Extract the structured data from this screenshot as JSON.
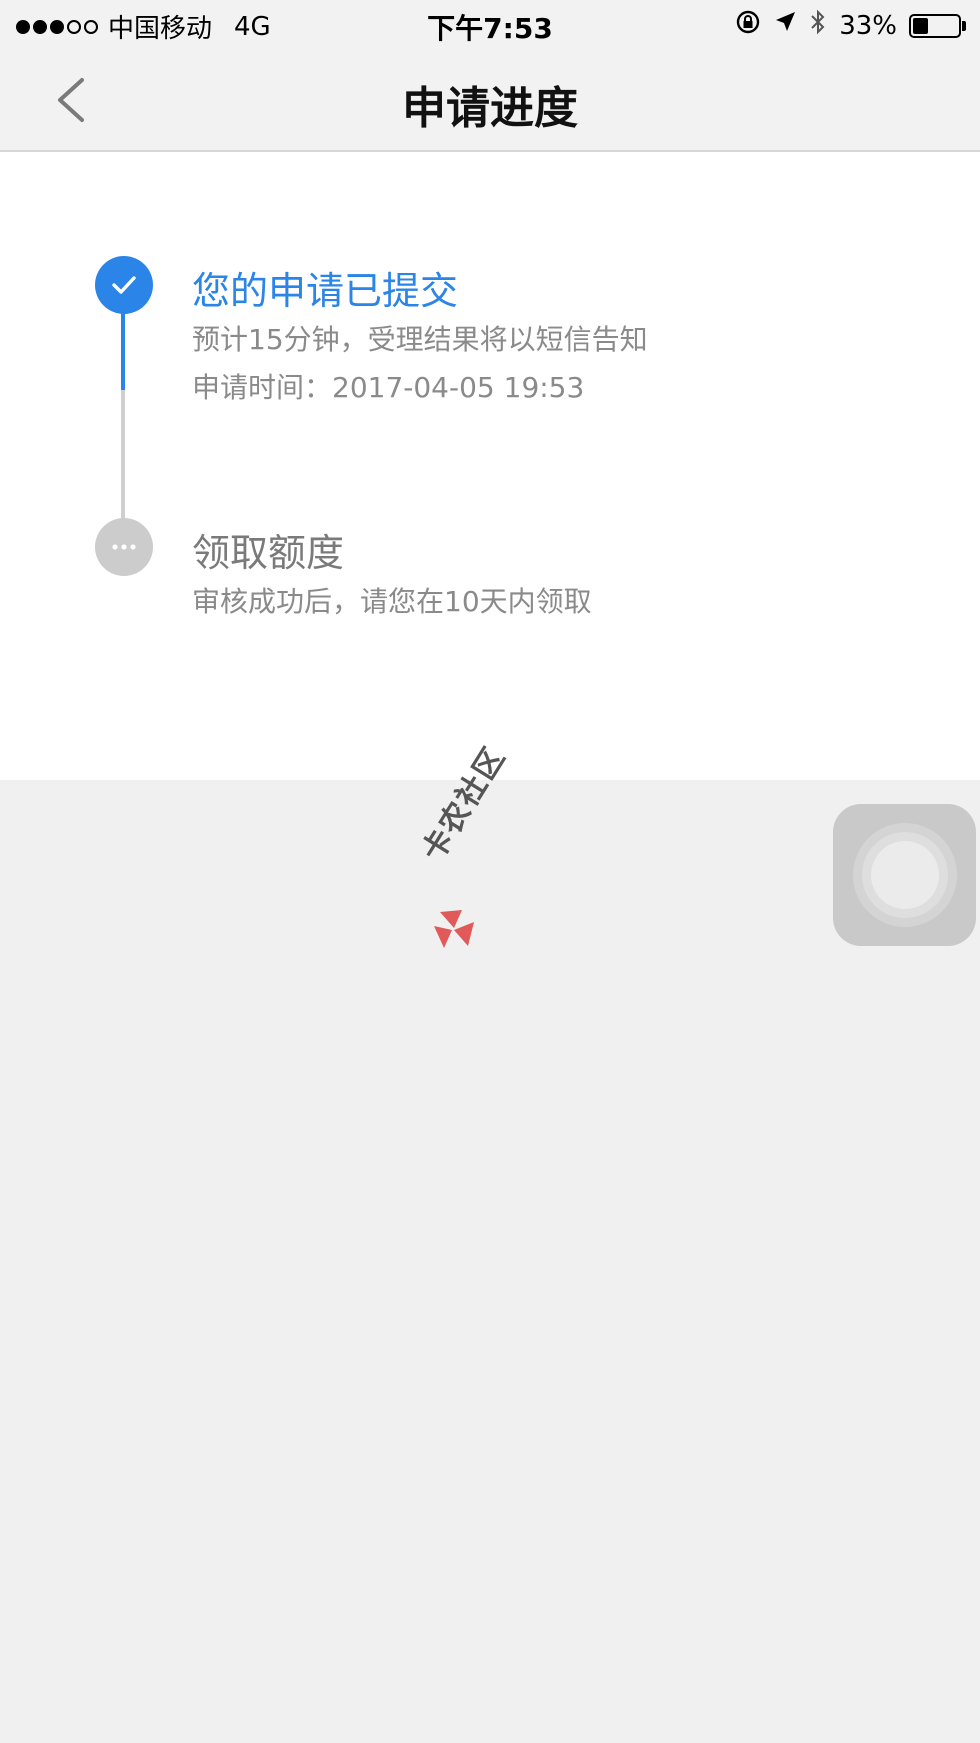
{
  "status_bar": {
    "signal": "●●●○○",
    "carrier": "中国移动",
    "network": "4G",
    "time": "下午7:53",
    "battery": "33%",
    "battery_level": 0.33
  },
  "header": {
    "title": "申请进度"
  },
  "steps": [
    {
      "title": "您的申请已提交",
      "desc": "预计15分钟，受理结果将以短信告知",
      "time": "申请时间：2017-04-05 19:53",
      "status": "done"
    },
    {
      "title": "领取额度",
      "desc": "审核成功后，请您在10天内领取",
      "status": "pending"
    }
  ],
  "watermark": {
    "text": "卡农社区"
  },
  "colors": {
    "accent": "#2b84e7",
    "pending": "#cccccc",
    "background": "#f0f0f0"
  }
}
